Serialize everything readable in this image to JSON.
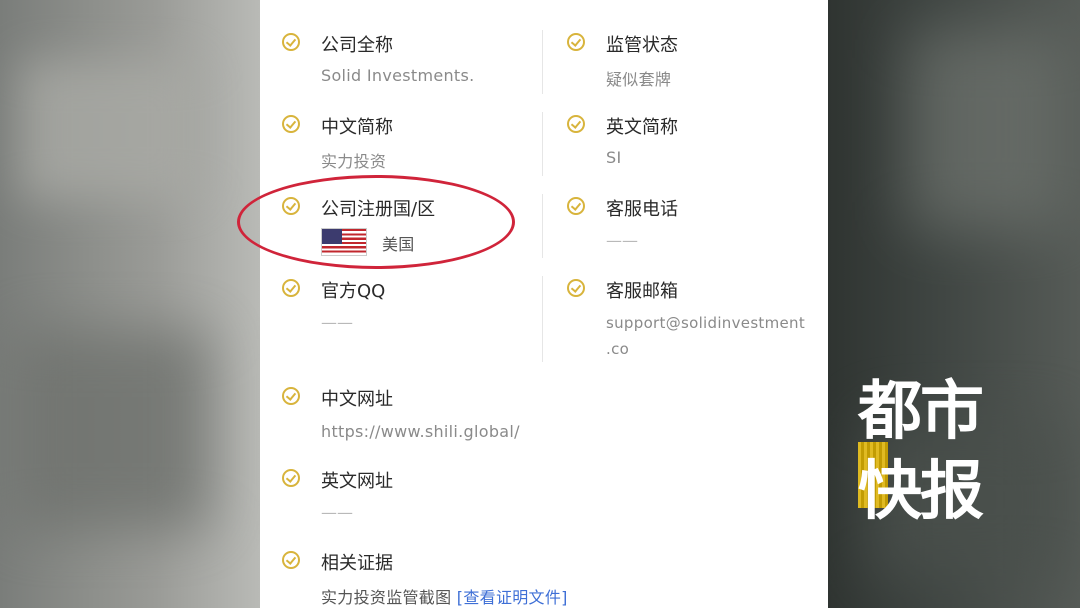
{
  "fields": {
    "company_full_name": {
      "label": "公司全称",
      "value": "Solid Investments."
    },
    "regulatory_status": {
      "label": "监管状态",
      "value": "疑似套牌"
    },
    "chinese_short_name": {
      "label": "中文简称",
      "value": "实力投资"
    },
    "english_short_name": {
      "label": "英文简称",
      "value": "SI"
    },
    "registration_country": {
      "label": "公司注册国/区",
      "value": "美国"
    },
    "service_phone": {
      "label": "客服电话",
      "value": "——"
    },
    "official_qq": {
      "label": "官方QQ",
      "value": "——"
    },
    "service_email": {
      "label": "客服邮箱",
      "value_line1": "support@solidinvestment",
      "value_line2": ".co"
    },
    "chinese_website": {
      "label": "中文网址",
      "value": "https://www.shili.global/"
    },
    "english_website": {
      "label": "英文网址",
      "value": "——"
    },
    "evidence": {
      "label": "相关证据",
      "value": "实力投资监管截图",
      "link": "[查看证明文件]"
    }
  },
  "watermark": {
    "line1": "都市",
    "line2": "快报"
  },
  "colors": {
    "check": "#d8b43c",
    "highlight_ellipse": "#d0243a",
    "link": "#3e6fd6"
  }
}
